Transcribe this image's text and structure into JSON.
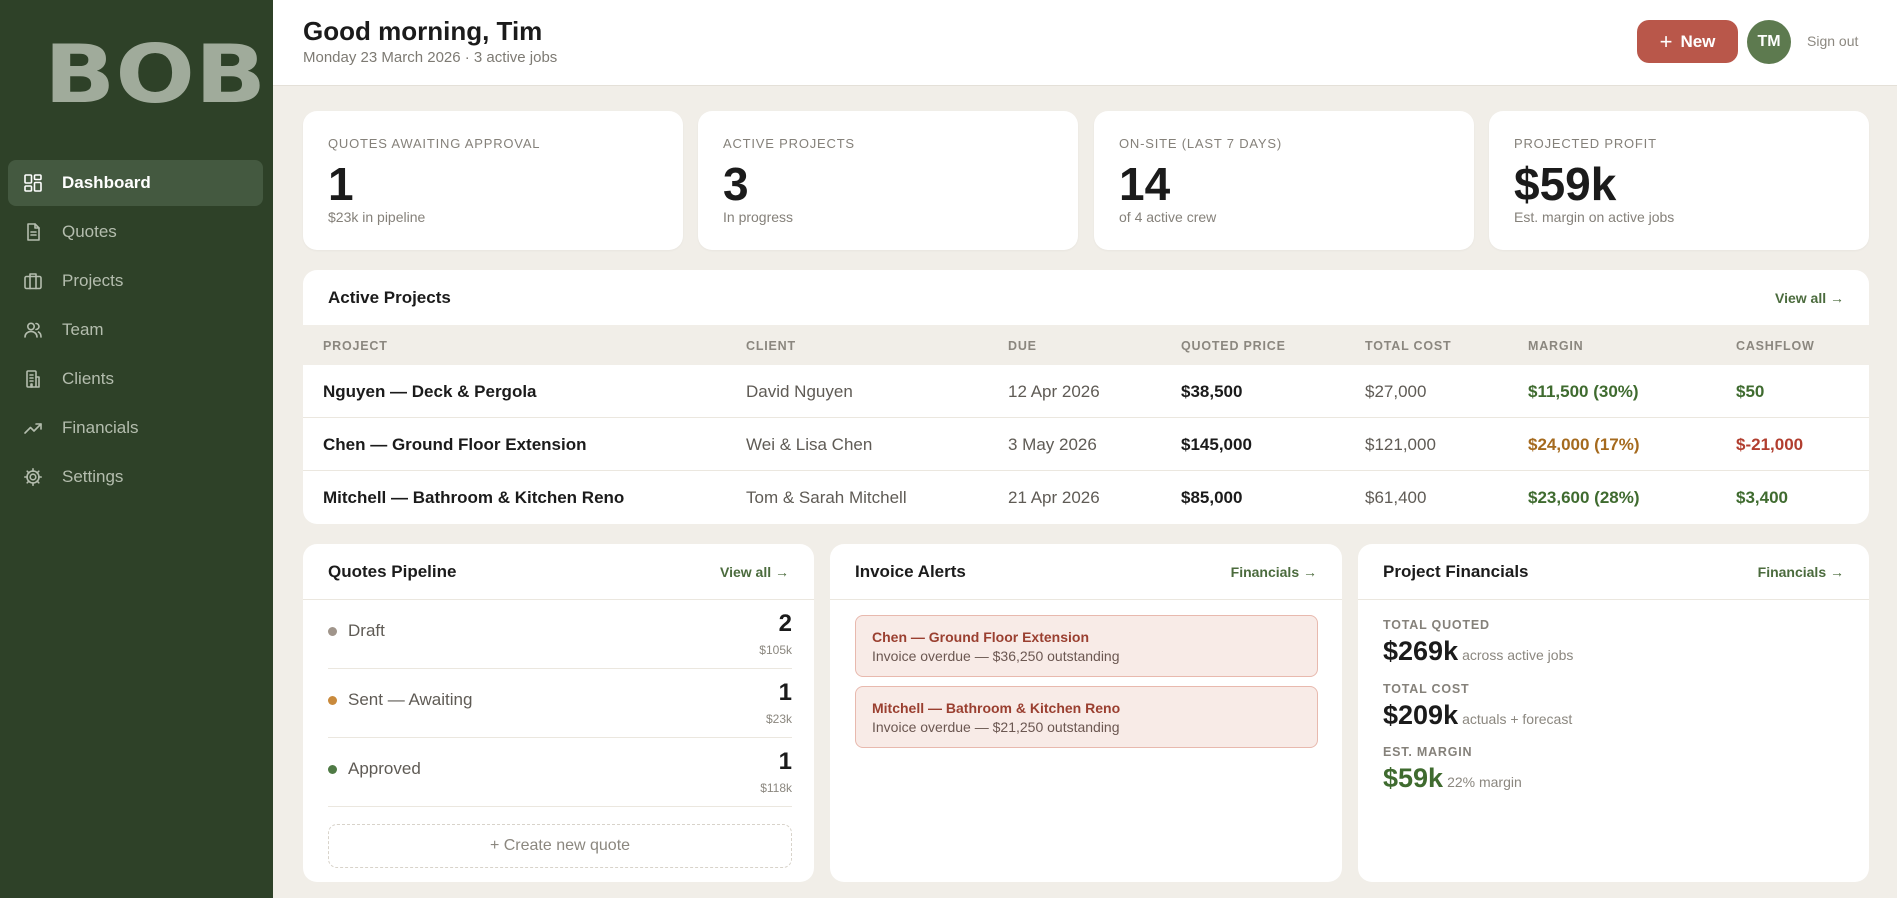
{
  "brand": {
    "logo": "BOB"
  },
  "sidebar": {
    "items": [
      {
        "label": "Dashboard",
        "icon": "dashboard-icon",
        "active": true
      },
      {
        "label": "Quotes",
        "icon": "document-icon"
      },
      {
        "label": "Projects",
        "icon": "briefcase-icon"
      },
      {
        "label": "Team",
        "icon": "users-icon"
      },
      {
        "label": "Clients",
        "icon": "building-icon"
      },
      {
        "label": "Financials",
        "icon": "trend-up-icon"
      },
      {
        "label": "Settings",
        "icon": "gear-icon"
      }
    ]
  },
  "header": {
    "greeting": "Good morning, Tim",
    "subline": "Monday 23 March 2026 · 3 active jobs",
    "new_button": "New",
    "avatar_initials": "TM",
    "signout": "Sign out"
  },
  "stats": [
    {
      "label": "QUOTES AWAITING APPROVAL",
      "value": "1",
      "sub": "$23k in pipeline"
    },
    {
      "label": "ACTIVE PROJECTS",
      "value": "3",
      "sub": "In progress"
    },
    {
      "label": "ON-SITE (LAST 7 DAYS)",
      "value": "14",
      "sub": "of 4 active crew"
    },
    {
      "label": "PROJECTED PROFIT",
      "value": "$59k",
      "sub": "Est. margin on active jobs"
    }
  ],
  "projects": {
    "title": "Active Projects",
    "view_all": "View all →",
    "columns": [
      "PROJECT",
      "CLIENT",
      "DUE",
      "QUOTED PRICE",
      "TOTAL COST",
      "MARGIN",
      "CASHFLOW"
    ],
    "rows": [
      {
        "project": "Nguyen — Deck & Pergola",
        "client": "David Nguyen",
        "due": "12 Apr 2026",
        "quoted": "$38,500",
        "cost": "$27,000",
        "margin": "$11,500 (30%)",
        "cashflow": "$50"
      },
      {
        "project": "Chen — Ground Floor Extension",
        "client": "Wei & Lisa Chen",
        "due": "3 May 2026",
        "quoted": "$145,000",
        "cost": "$121,000",
        "margin": "$24,000 (17%)",
        "cashflow": "$-21,000"
      },
      {
        "project": "Mitchell — Bathroom & Kitchen Reno",
        "client": "Tom & Sarah Mitchell",
        "due": "21 Apr 2026",
        "quoted": "$85,000",
        "cost": "$61,400",
        "margin": "$23,600 (28%)",
        "cashflow": "$3,400"
      }
    ]
  },
  "pipeline": {
    "title": "Quotes Pipeline",
    "view_all": "View all →",
    "stages": [
      {
        "name": "Draft",
        "count": "2",
        "amount": "$105k",
        "color": "#a0958b"
      },
      {
        "name": "Sent — Awaiting",
        "count": "1",
        "amount": "$23k",
        "color": "#c98a3c"
      },
      {
        "name": "Approved",
        "count": "1",
        "amount": "$118k",
        "color": "#4f7a45"
      }
    ],
    "create": "+ Create new quote"
  },
  "invoices": {
    "title": "Invoice Alerts",
    "link": "Financials →",
    "alerts": [
      {
        "title": "Chen — Ground Floor Extension",
        "text": "Invoice overdue — $36,250 outstanding"
      },
      {
        "title": "Mitchell — Bathroom & Kitchen Reno",
        "text": "Invoice overdue — $21,250 outstanding"
      }
    ]
  },
  "financials": {
    "title": "Project Financials",
    "link": "Financials →",
    "blocks": [
      {
        "label": "TOTAL QUOTED",
        "value": "$269k",
        "note": "across active jobs"
      },
      {
        "label": "TOTAL COST",
        "value": "$209k",
        "note": "actuals + forecast"
      },
      {
        "label": "EST. MARGIN",
        "value": "$59k",
        "note": "22% margin"
      }
    ]
  },
  "colors": {
    "sidebar": "#2e4128",
    "accent": "#b9574a",
    "positive": "#3f6b2f",
    "warning": "#a56a1e",
    "negative": "#b13e2f"
  }
}
